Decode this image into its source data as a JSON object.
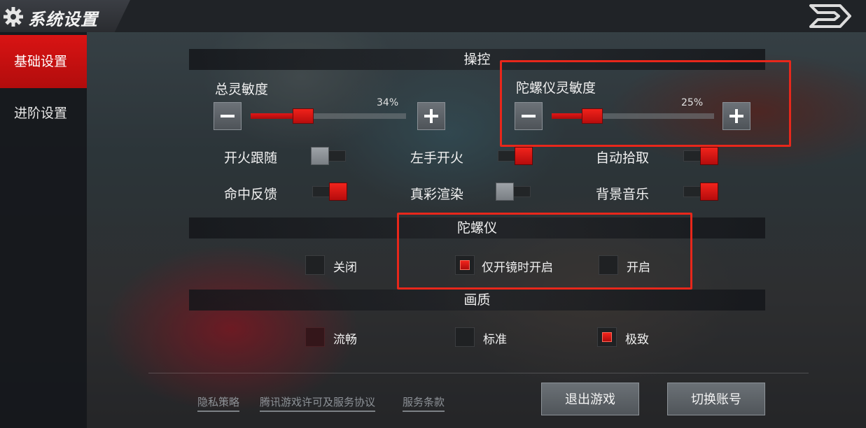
{
  "header": {
    "title": "系统设置",
    "gear_icon": "gear-icon",
    "back_icon": "back-arrow-icon"
  },
  "sidebar": {
    "items": [
      {
        "label": "基础设置",
        "active": true
      },
      {
        "label": "进阶设置",
        "active": false
      }
    ]
  },
  "controls": {
    "title": "操控",
    "total_sensitivity": {
      "label": "总灵敏度",
      "value_text": "34%",
      "value": 0.34
    },
    "gyro_sensitivity": {
      "label": "陀螺仪灵敏度",
      "value_text": "25%",
      "value": 0.25
    },
    "toggles": [
      {
        "label": "开火跟随",
        "on": false
      },
      {
        "label": "左手开火",
        "on": true
      },
      {
        "label": "自动拾取",
        "on": true
      },
      {
        "label": "命中反馈",
        "on": true
      },
      {
        "label": "真彩渲染",
        "on": false
      },
      {
        "label": "背景音乐",
        "on": true
      }
    ]
  },
  "gyroscope": {
    "title": "陀螺仪",
    "options": [
      {
        "label": "关闭",
        "selected": false
      },
      {
        "label": "仅开镜时开启",
        "selected": true
      },
      {
        "label": "开启",
        "selected": false
      }
    ]
  },
  "quality": {
    "title": "画质",
    "options": [
      {
        "label": "流畅",
        "selected": false
      },
      {
        "label": "标准",
        "selected": false
      },
      {
        "label": "极致",
        "selected": true
      }
    ]
  },
  "footer": {
    "links": [
      "隐私策略",
      "腾讯游戏许可及服务协议",
      "服务条款"
    ],
    "exit_label": "退出游戏",
    "switch_label": "切换账号"
  },
  "colors": {
    "accent": "#d91414",
    "highlight_box": "#e8271b"
  }
}
